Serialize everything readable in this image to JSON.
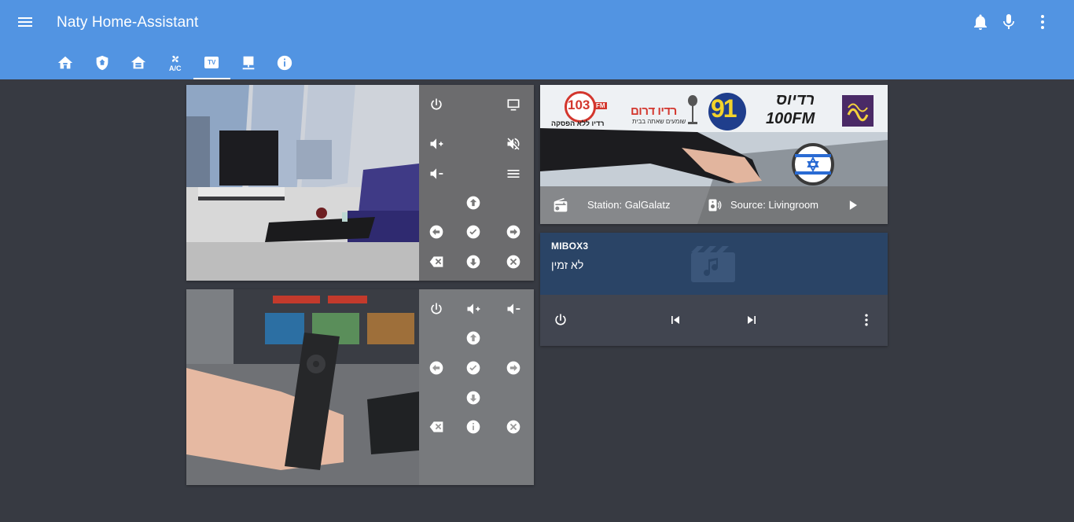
{
  "header": {
    "title": "Naty Home-Assistant",
    "icons": [
      "menu-icon",
      "bell-icon",
      "microphone-icon",
      "more-vertical-icon"
    ]
  },
  "tabs": [
    {
      "name": "home-icon",
      "active": false
    },
    {
      "name": "security-shield-icon",
      "active": false
    },
    {
      "name": "house-icon",
      "active": false
    },
    {
      "name": "ac-fan-icon",
      "label": "A/C",
      "active": false
    },
    {
      "name": "tv-icon",
      "label": "TV",
      "active": true
    },
    {
      "name": "desktop-icon",
      "active": false
    },
    {
      "name": "info-icon",
      "active": false
    }
  ],
  "radio": {
    "station_label": "Station: GalGalatz",
    "source_label": "Source: Livingroom",
    "logos": {
      "logo_103": "103",
      "logo_103_fm": "FM",
      "logo_103_tag": "רדיו ללא הפסקה",
      "logo_darom": "רדיו דרום",
      "logo_darom_tag": "שומעים שאתה בבית",
      "logo_91": "91",
      "logo_100": "רדיוס",
      "logo_100_num": "100FM"
    }
  },
  "media_player": {
    "name": "MIBOX3",
    "status": "לא זמין"
  },
  "colors": {
    "header": "#5294e2",
    "background": "#373a42",
    "media_top": "#2a4466",
    "media_card": "#414550"
  }
}
